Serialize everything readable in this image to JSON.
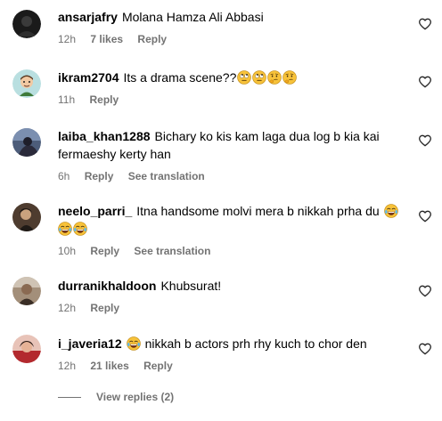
{
  "comments": [
    {
      "username": "ansarjafry",
      "text": "Molana Hamza Ali Abbasi",
      "time": "12h",
      "likes": "7 likes",
      "reply": "Reply"
    },
    {
      "username": "ikram2704",
      "text": "Its a drama scene??",
      "time": "11h",
      "reply": "Reply",
      "emoji_names": [
        "rolling-eyes-emoji",
        "rolling-eyes-emoji",
        "thinking-emoji",
        "thinking-emoji"
      ]
    },
    {
      "username": "laiba_khan1288",
      "text_line1": "Bichary ko kis kam laga dua log b kia kai",
      "text_line2": "fermaeshy kerty han",
      "time": "6h",
      "reply": "Reply",
      "see_translation": "See translation"
    },
    {
      "username": "neelo_parri_",
      "text": "Itna handsome molvi mera b nikkah prha du",
      "time": "10h",
      "reply": "Reply",
      "see_translation": "See translation",
      "emoji_names": [
        "laughing-emoji",
        "laughing-emoji",
        "laughing-emoji"
      ]
    },
    {
      "username": "durranikhaldoon",
      "text": "Khubsurat!",
      "time": "12h",
      "reply": "Reply"
    },
    {
      "username": "i_javeria12",
      "text": "nikkah b actors prh rhy kuch to chor den",
      "time": "12h",
      "likes": "21 likes",
      "reply": "Reply",
      "emoji_names": [
        "laughing-emoji"
      ]
    }
  ],
  "view_replies": "View replies (2)",
  "colors": {
    "meta_gray": "#737373",
    "text": "#000000",
    "background": "#ffffff",
    "emoji_yellow": "#f7c23a"
  },
  "icons": {
    "like": "heart-outline-icon"
  }
}
